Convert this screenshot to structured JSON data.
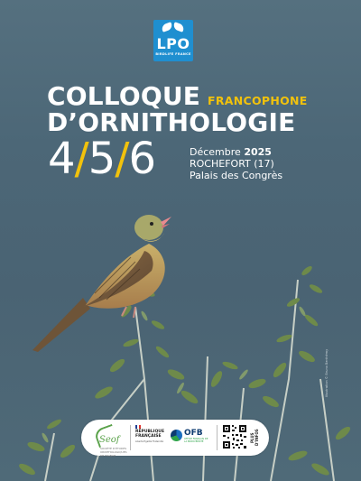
{
  "logo": {
    "name": "LPO",
    "subtitle": "BIRDLIFE FRANCE",
    "color": "#1f8fd0"
  },
  "title": {
    "line1": "COLLOQUE",
    "line1_accent": "FRANCOPHONE",
    "line2": "D’ORNITHOLOGIE"
  },
  "dates": {
    "days": [
      "4",
      "5",
      "6"
    ],
    "separator": "/",
    "month": "Décembre",
    "year": "2025",
    "city": "ROCHEFORT (17)",
    "venue": "Palais des Congrès"
  },
  "colors": {
    "accent": "#f2c20c",
    "background": "#4c6777",
    "text": "#ffffff"
  },
  "credit": "Illustration © Bruno Berthémy",
  "partners": {
    "seof": {
      "name": "Seof",
      "tagline": "SOCIÉTÉ D’ÉTUDES ORNITHOLOGIQUES DE FRANCE"
    },
    "republique": {
      "line1": "RÉPUBLIQUE",
      "line2": "FRANÇAISE",
      "motto": "Liberté Égalité Fraternité"
    },
    "ofb": {
      "name": "OFB",
      "sub": "OFFICE FRANÇAIS DE LA BIODIVERSITÉ"
    },
    "qr_label": "PLUS D’INFOS"
  }
}
